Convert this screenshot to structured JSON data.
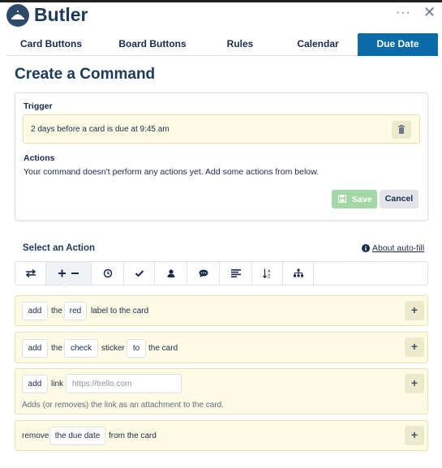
{
  "app": {
    "title": "Butler"
  },
  "header": {
    "more_label": "···",
    "close_label": "✕"
  },
  "tabs": [
    {
      "label": "Card Buttons",
      "active": false
    },
    {
      "label": "Board Buttons",
      "active": false
    },
    {
      "label": "Rules",
      "active": false
    },
    {
      "label": "Calendar",
      "active": false
    },
    {
      "label": "Due Date",
      "active": true
    }
  ],
  "page_title": "Create a Command",
  "command": {
    "trigger_label": "Trigger",
    "trigger_text": "2 days before a card is due at 9:45 am",
    "actions_label": "Actions",
    "actions_empty": "Your command doesn't perform any actions yet. Add some actions from below.",
    "save_label": "Save",
    "cancel_label": "Cancel"
  },
  "select_action": {
    "title": "Select an Action",
    "autofill_label": "About auto-fill"
  },
  "toolbar_icons": [
    "move-arrows-icon",
    "add-remove-icon",
    "clock-icon",
    "checkmark-icon",
    "member-icon",
    "comment-icon",
    "description-icon",
    "sort-icon",
    "hierarchy-icon"
  ],
  "actions": [
    {
      "verb": "add",
      "the": "the",
      "label_color": "red",
      "rest": "label to the card"
    },
    {
      "verb": "add",
      "the": "the",
      "sticker": "check",
      "mid": "sticker",
      "to": "to",
      "rest": "the card"
    },
    {
      "verb": "add",
      "link_word": "link",
      "placeholder": "https://trello.com",
      "hint": "Adds (or removes) the link as an attachment to the card."
    },
    {
      "verb": "remove",
      "field": "the due date",
      "rest": "from the card"
    }
  ],
  "plus_label": "+",
  "colors": {
    "accent": "#0b6aa8",
    "title": "#1c3b5a",
    "card_bg": "#fdfbe3",
    "save_bg": "#a3d7a6"
  }
}
